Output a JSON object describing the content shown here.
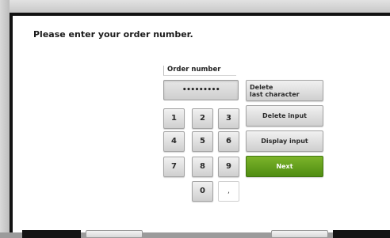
{
  "prompt": "Please enter your order number.",
  "field_label": "Order number",
  "display_value": "•••••••••",
  "keypad": {
    "k1": "1",
    "k2": "2",
    "k3": "3",
    "k4": "4",
    "k5": "5",
    "k6": "6",
    "k7": "7",
    "k8": "8",
    "k9": "9",
    "k0": "0",
    "kdot": ","
  },
  "actions": {
    "delete_last_line1": "Delete",
    "delete_last_line2": "last character",
    "delete_input": "Delete input",
    "display_input": "Display input",
    "next": "Next"
  },
  "colors": {
    "next_button": "#5f9e1c"
  }
}
